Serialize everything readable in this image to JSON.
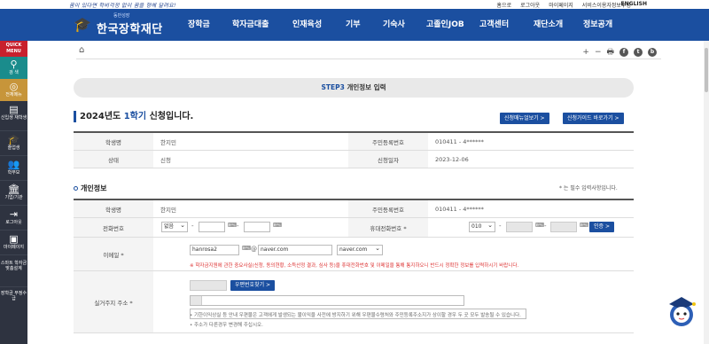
{
  "top": {
    "slogan": "꿈이 있다면 학비걱정 없이 꿈을 향해 달려요!",
    "links": [
      "홈으로",
      "로그아웃",
      "마이페이지",
      "서비스이용자정보수정"
    ],
    "english": "ENGLISH"
  },
  "nav": {
    "logo_small": "동반성장",
    "logo_name": "한국장학재단",
    "items": [
      "장학금",
      "학자금대출",
      "인재육성",
      "기부",
      "기숙사",
      "고졸인JOB",
      "고객센터",
      "재단소개",
      "정보공개"
    ]
  },
  "sidebar": {
    "quick_menu": [
      "QUICK",
      "MENU"
    ],
    "items": [
      {
        "icon": "search-icon",
        "label": "검 색"
      },
      {
        "icon": "compass-icon",
        "label": "전체메뉴"
      },
      {
        "icon": "book-icon",
        "label": "신입생 재학생"
      },
      {
        "icon": "graduation-icon",
        "label": "졸업생"
      },
      {
        "icon": "parents-icon",
        "label": "학부모"
      },
      {
        "icon": "institution-icon",
        "label": "기업/기관"
      },
      {
        "icon": "logout-icon",
        "label": "로그아웃"
      },
      {
        "icon": "mypage-icon",
        "label": "마이페이지"
      },
      {
        "icon": "smart-icon",
        "label": "스마트 학자금 맞춤설계"
      },
      {
        "icon": "scholar-icon",
        "label": "장학금 부정수급"
      }
    ]
  },
  "toolbar": {
    "icons": [
      "+",
      "−",
      "print",
      "f",
      "t",
      "b"
    ]
  },
  "step": {
    "step_label": "STEP3",
    "title": "개인정보 입력"
  },
  "semester": {
    "year": "2024년도",
    "term": "1학기",
    "suffix": "신청입니다."
  },
  "buttons": {
    "manual": "신청매뉴얼보기 >",
    "guide": "신청가이드 바로가기 >",
    "verify": "인증 >",
    "zipcode": "우편번호찾기 >"
  },
  "summary": {
    "rows": [
      {
        "l1": "학생명",
        "v1": "한지민",
        "l2": "주민등록번호",
        "v2": "010411 - 4******"
      },
      {
        "l1": "상태",
        "v1": "신청",
        "l2": "신청일자",
        "v2": "2023-12-06"
      }
    ]
  },
  "personal": {
    "section_title": "개인정보",
    "required_note": "* 는 필수 입력사항입니다.",
    "name_label": "학생명",
    "name_value": "한지민",
    "ssn_label": "주민등록번호",
    "ssn_value": "010411 - 4******",
    "phone_label": "전화번호",
    "phone_area": "없음",
    "phone_dash": "-",
    "mobile_label": "휴대전화번호 *",
    "mobile_prefix": "010",
    "email_label": "이메일 *",
    "email_id": "hanrosa2",
    "email_at": "@",
    "email_domain": "naver.com",
    "email_select": "naver.com",
    "email_note": "※ 학자금지원에 관한 중요사실(신청, 동의현황, 소득산정 결과, 심사 등)을 휴대전화번호 및 이메일을 통해 통지하오니 반드시 정확한 정보를 입력하시기 바랍니다.",
    "address_label": "실거주지 주소 *",
    "address_note1": "• 기한이익상실 등 안내 우편물은 고객에게 발생되는 불이익을 사전에 방지하기 위해 우편물수령처와 주민등록주소지가 상이할 경우 두 곳 모두 발송될 수 있습니다.",
    "address_note2": "• 주소가 다른경우 변경해 주십시오."
  },
  "colors": {
    "brand": "#1b4fa0",
    "quick_menu": "#c8202d",
    "sidebar": "#2e3340"
  }
}
